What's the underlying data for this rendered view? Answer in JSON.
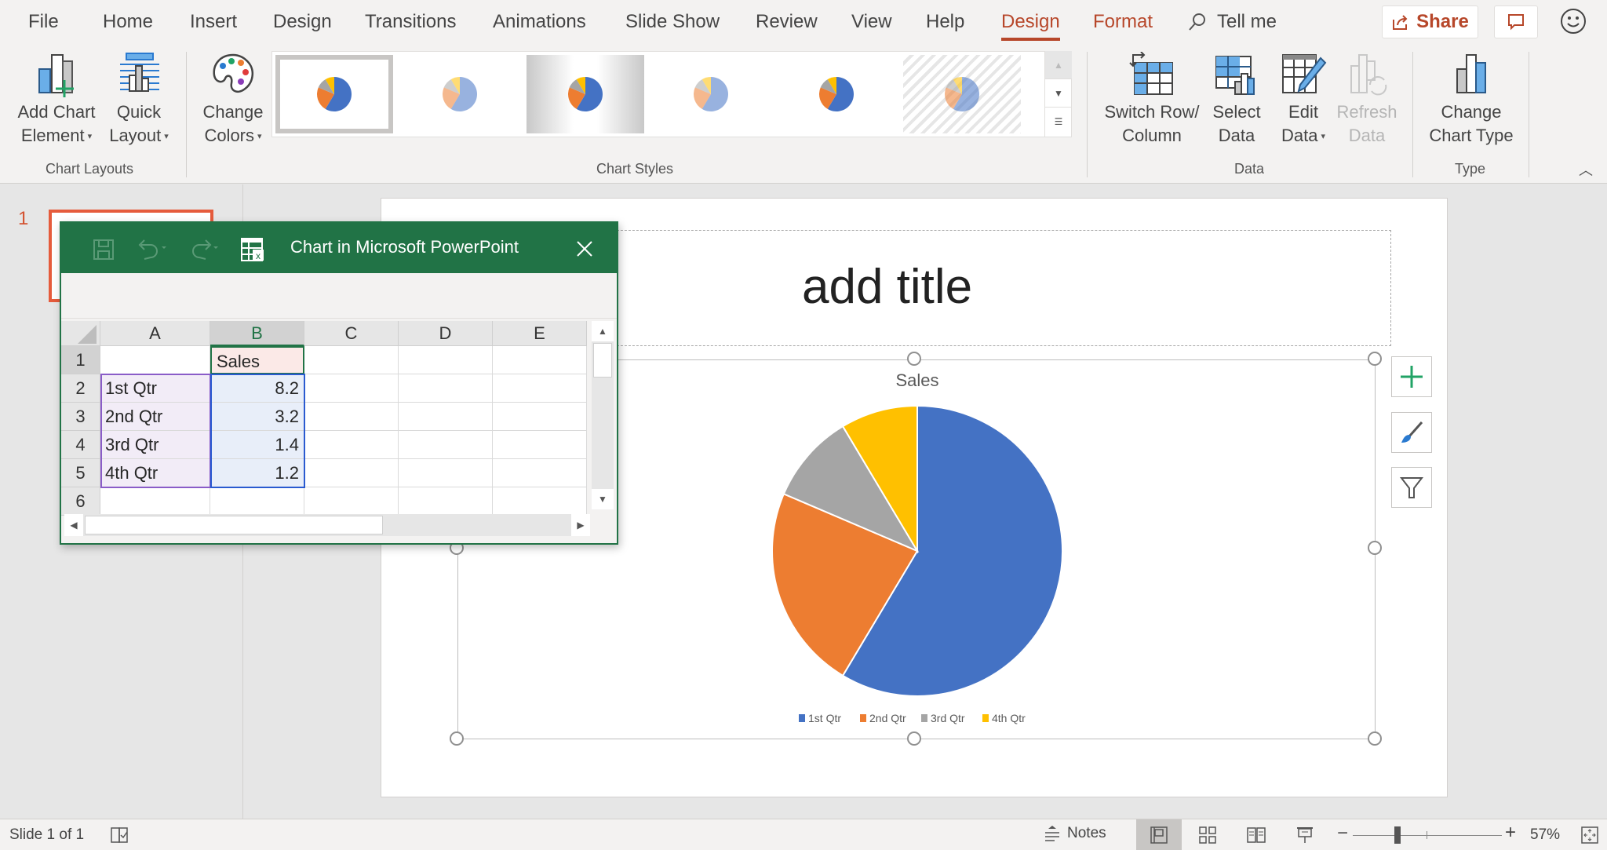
{
  "tabs": [
    {
      "label": "File"
    },
    {
      "label": "Home"
    },
    {
      "label": "Insert"
    },
    {
      "label": "Design"
    },
    {
      "label": "Transitions"
    },
    {
      "label": "Animations"
    },
    {
      "label": "Slide Show"
    },
    {
      "label": "Review"
    },
    {
      "label": "View"
    },
    {
      "label": "Help"
    },
    {
      "label": "Design",
      "active": true,
      "contextual": true
    },
    {
      "label": "Format",
      "contextual": true
    }
  ],
  "tell_me": "Tell me",
  "share_label": "Share",
  "ribbon": {
    "chart_layouts": {
      "group_label": "Chart Layouts",
      "add_chart_element": [
        "Add Chart",
        "Element"
      ],
      "quick_layout": [
        "Quick",
        "Layout"
      ]
    },
    "chart_styles": {
      "group_label": "Chart Styles",
      "change_colors": [
        "Change",
        "Colors"
      ],
      "style_count": 6,
      "selected_index": 0
    },
    "data": {
      "group_label": "Data",
      "switch_row_column": [
        "Switch Row/",
        "Column"
      ],
      "select_data": [
        "Select",
        "Data"
      ],
      "edit_data": [
        "Edit",
        "Data"
      ],
      "refresh_data": [
        "Refresh",
        "Data"
      ]
    },
    "type": {
      "group_label": "Type",
      "change_chart_type": [
        "Change",
        "Chart Type"
      ]
    }
  },
  "thumbnails": {
    "slide_number": "1"
  },
  "slide": {
    "title_placeholder": "add title"
  },
  "excel": {
    "window_title": "Chart in Microsoft PowerPoint",
    "columns": [
      "A",
      "B",
      "C",
      "D",
      "E"
    ],
    "selected_column": "B",
    "rows": [
      {
        "n": "1",
        "a": "",
        "b": "Sales"
      },
      {
        "n": "2",
        "a": "1st Qtr",
        "b": "8.2"
      },
      {
        "n": "3",
        "a": "2nd Qtr",
        "b": "3.2"
      },
      {
        "n": "4",
        "a": "3rd Qtr",
        "b": "1.4"
      },
      {
        "n": "5",
        "a": "4th Qtr",
        "b": "1.2"
      },
      {
        "n": "6",
        "a": "",
        "b": ""
      }
    ]
  },
  "chart_data": {
    "type": "pie",
    "title": "Sales",
    "categories": [
      "1st Qtr",
      "2nd Qtr",
      "3rd Qtr",
      "4th Qtr"
    ],
    "values": [
      8.2,
      3.2,
      1.4,
      1.2
    ],
    "colors": [
      "#4472c4",
      "#ed7d31",
      "#a5a5a5",
      "#ffc000"
    ],
    "legend": "bottom"
  },
  "status": {
    "slide_info": "Slide 1 of 1",
    "notes_label": "Notes",
    "zoom": "57%",
    "zoom_fraction": 0.3
  }
}
